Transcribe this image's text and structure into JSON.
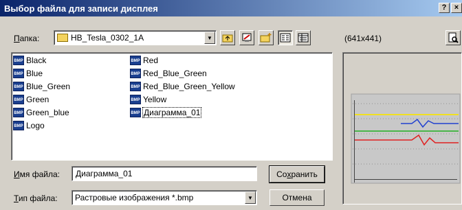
{
  "window": {
    "title": "Выбор файла для записи дисплея",
    "help_glyph": "?",
    "close_glyph": "×"
  },
  "lookin": {
    "label_hot": "П",
    "label_rest": "апка:",
    "value": "HB_Tesla_0302_1A"
  },
  "preview": {
    "size_label": "(641x441)"
  },
  "files": {
    "col1": [
      "Black",
      "Blue",
      "Blue_Green",
      "Green",
      "Green_blue",
      "Logo"
    ],
    "col2": [
      "Red",
      "Red_Blue_Green",
      "Red_Blue_Green_Yellow",
      "Yellow",
      "Диаграмма_01"
    ],
    "selected": "Диаграмма_01",
    "icon_text": "BMP"
  },
  "filename": {
    "label_hot": "И",
    "label_rest": "мя файла:",
    "value": "Диаграмма_01"
  },
  "filetype": {
    "label_hot": "Т",
    "label_rest": "ип файла:",
    "value": "Растровые изображения *.bmp"
  },
  "buttons": {
    "save_pre": "Со",
    "save_hot": "х",
    "save_post": "ранить",
    "cancel": "Отмена"
  },
  "colors": {
    "title_start": "#0a246a",
    "title_end": "#a6caf0",
    "line_yellow": "#f0e020",
    "line_blue": "#2040d0",
    "line_green": "#20b020",
    "line_red": "#e02020"
  }
}
